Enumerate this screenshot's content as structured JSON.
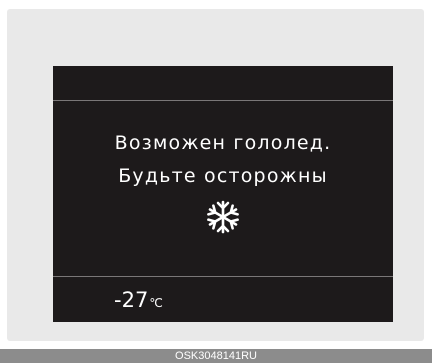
{
  "display": {
    "message_line1": "Возможен гололед.",
    "message_line2": "Будьте осторожны",
    "icon": "snowflake-icon",
    "outside_temperature": {
      "value": "-27",
      "unit": "℃"
    }
  },
  "caption": "OSK3048141RU",
  "colors": {
    "screen_background": "#1d1a1b",
    "text": "#ffffff",
    "divider": "#7a7778",
    "caption_bar": "#8c8c8c"
  }
}
